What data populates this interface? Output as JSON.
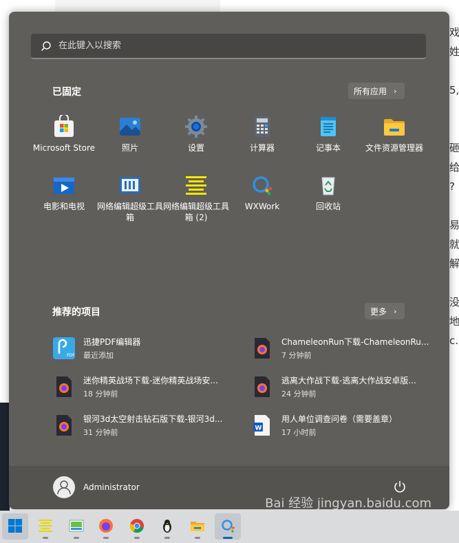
{
  "background": {
    "right_text": [
      "戏",
      "姓利",
      "",
      "5,",
      "",
      "",
      "砸",
      "给",
      "?",
      "",
      "易",
      "就",
      "解",
      "",
      "没有",
      "地图",
      "c.."
    ],
    "watermark": "Bai 经验 jingyan.baidu.com"
  },
  "search": {
    "placeholder": "在此键入以搜索"
  },
  "pinned": {
    "title": "已固定",
    "all_apps_label": "所有应用",
    "apps": [
      {
        "label": "Microsoft Store",
        "icon": "microsoft-store-icon"
      },
      {
        "label": "照片",
        "icon": "photos-icon"
      },
      {
        "label": "设置",
        "icon": "settings-gear-icon"
      },
      {
        "label": "计算器",
        "icon": "calculator-icon"
      },
      {
        "label": "记事本",
        "icon": "notepad-icon"
      },
      {
        "label": "文件资源管理器",
        "icon": "file-explorer-icon"
      },
      {
        "label": "电影和电视",
        "icon": "movies-tv-icon"
      },
      {
        "label": "网络编辑超级工具箱",
        "icon": "web-editor-toolbox-icon"
      },
      {
        "label": "网络编辑超级工具箱 (2)",
        "icon": "web-editor-toolbox-yellow-icon"
      },
      {
        "label": "WXWork",
        "icon": "wxwork-icon"
      },
      {
        "label": "回收站",
        "icon": "recycle-bin-icon"
      }
    ]
  },
  "recommended": {
    "title": "推荐的项目",
    "more_label": "更多",
    "items": [
      {
        "name": "迅捷PDF编辑器",
        "time": "最近添加",
        "icon": "pdf-editor-icon"
      },
      {
        "name": "ChameleonRun下载-ChameleonRu...",
        "time": "7 分钟前",
        "icon": "firefox-document-icon"
      },
      {
        "name": "迷你精英战场下载-迷你精英战场安...",
        "time": "18 分钟前",
        "icon": "firefox-document-icon"
      },
      {
        "name": "逃离大作战下载-逃离大作战安卓版...",
        "time": "24 分钟前",
        "icon": "firefox-document-icon"
      },
      {
        "name": "银河3d太空射击钻石版下载-银河3d...",
        "time": "31 分钟前",
        "icon": "firefox-document-icon"
      },
      {
        "name": "用人单位调查问卷（需要盖章）",
        "time": "17 小时前",
        "icon": "word-document-icon"
      }
    ]
  },
  "user": {
    "name": "Administrator"
  },
  "taskbar": {
    "items": [
      "start-button",
      "web-editor-toolbox",
      "image-viewer",
      "firefox",
      "chrome",
      "penguin-app",
      "file-explorer",
      "wxwork"
    ]
  },
  "colors": {
    "menu_bg": "#5f5e5b",
    "taskbar_bg": "#d9dbdd",
    "accent": "#0067c0"
  }
}
